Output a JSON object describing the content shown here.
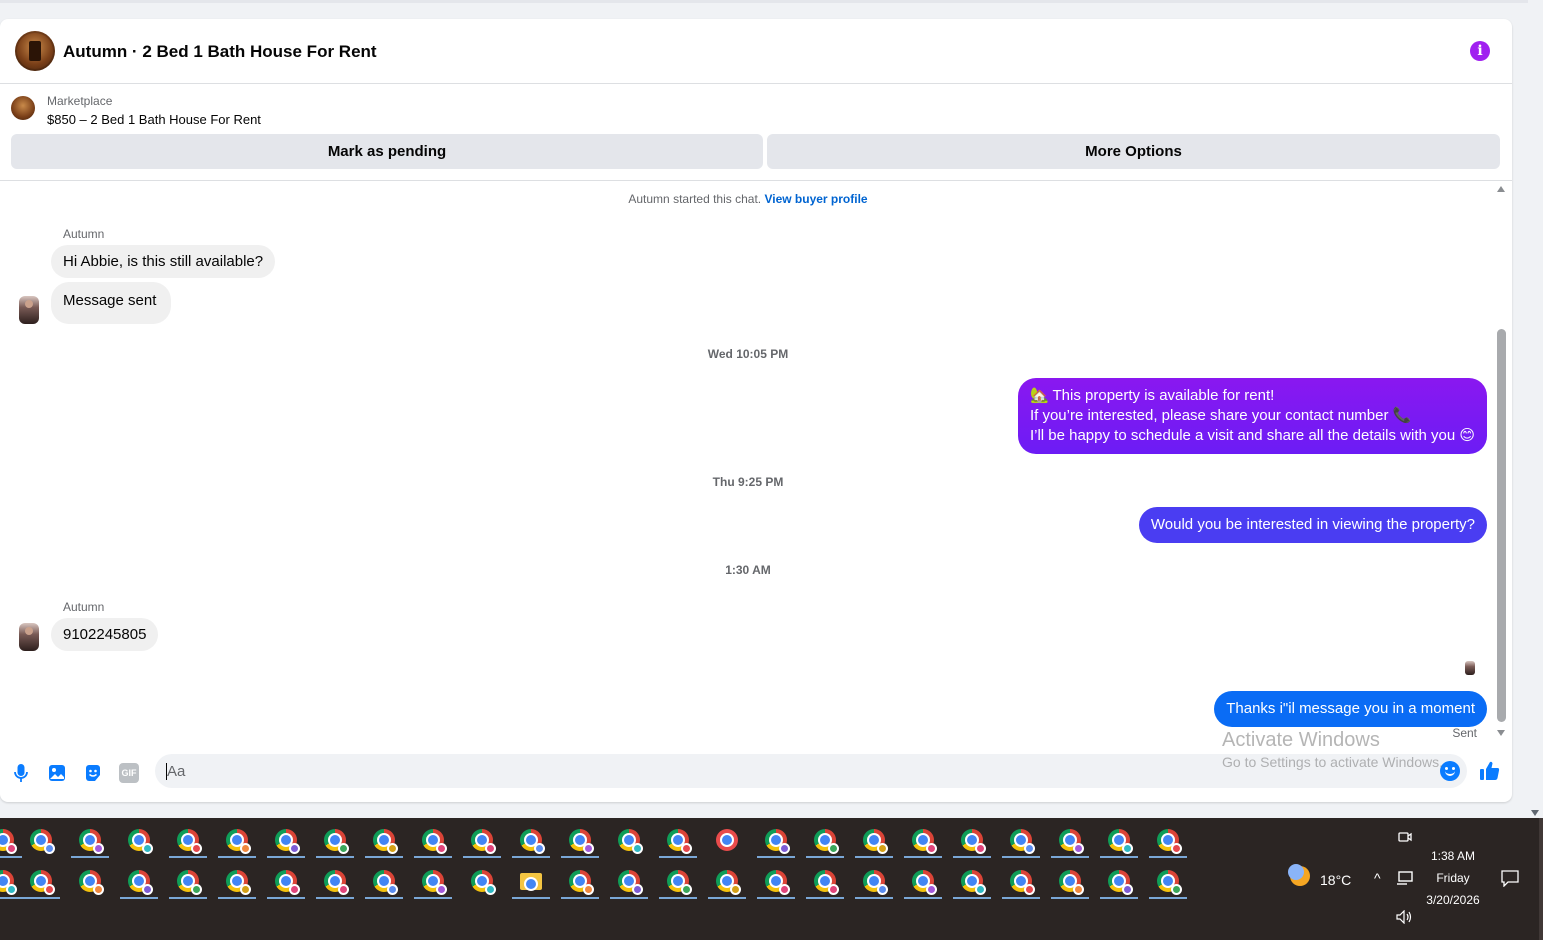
{
  "header": {
    "title": "Autumn · 2 Bed 1 Bath House For Rent"
  },
  "marketplace": {
    "label": "Marketplace",
    "listing": "$850 – 2 Bed 1 Bath House For Rent",
    "mark_pending": "Mark as pending",
    "more_options": "More Options"
  },
  "chat": {
    "system_text": "Autumn started this chat.",
    "system_link": "View buyer profile",
    "messages": [
      {
        "sender": "Autumn",
        "text": "Hi Abbie, is this still available?"
      },
      {
        "text": "Message sent"
      },
      {
        "timestamp": "Wed 10:05 PM"
      },
      {
        "line1": "🏡 This property is available for rent!",
        "line2": "If you’re interested, please share your contact number 📞",
        "line3": "I’ll be happy to schedule a visit and share all the details with you 😊"
      },
      {
        "timestamp": "Thu 9:25 PM"
      },
      {
        "text": "Would you be interested in viewing the property?"
      },
      {
        "timestamp": "1:30 AM"
      },
      {
        "sender": "Autumn",
        "text": "9102245805"
      },
      {
        "text": "Thanks i\"il message you in a moment"
      }
    ],
    "status": "Sent"
  },
  "composer": {
    "placeholder": "Aa",
    "gif_label": "GIF"
  },
  "watermark": {
    "title": "Activate Windows",
    "subtitle": "Go to Settings to activate Windows."
  },
  "taskbar": {
    "temperature": "18°C",
    "time": "1:38 AM",
    "day": "Friday",
    "date": "3/20/2026"
  },
  "colors": {
    "bubble_gradient": "#7a1cf3",
    "bubble_indigo": "#4a3df2",
    "bubble_blue": "#0a6cf5",
    "accent_blue": "#0a7cff"
  }
}
